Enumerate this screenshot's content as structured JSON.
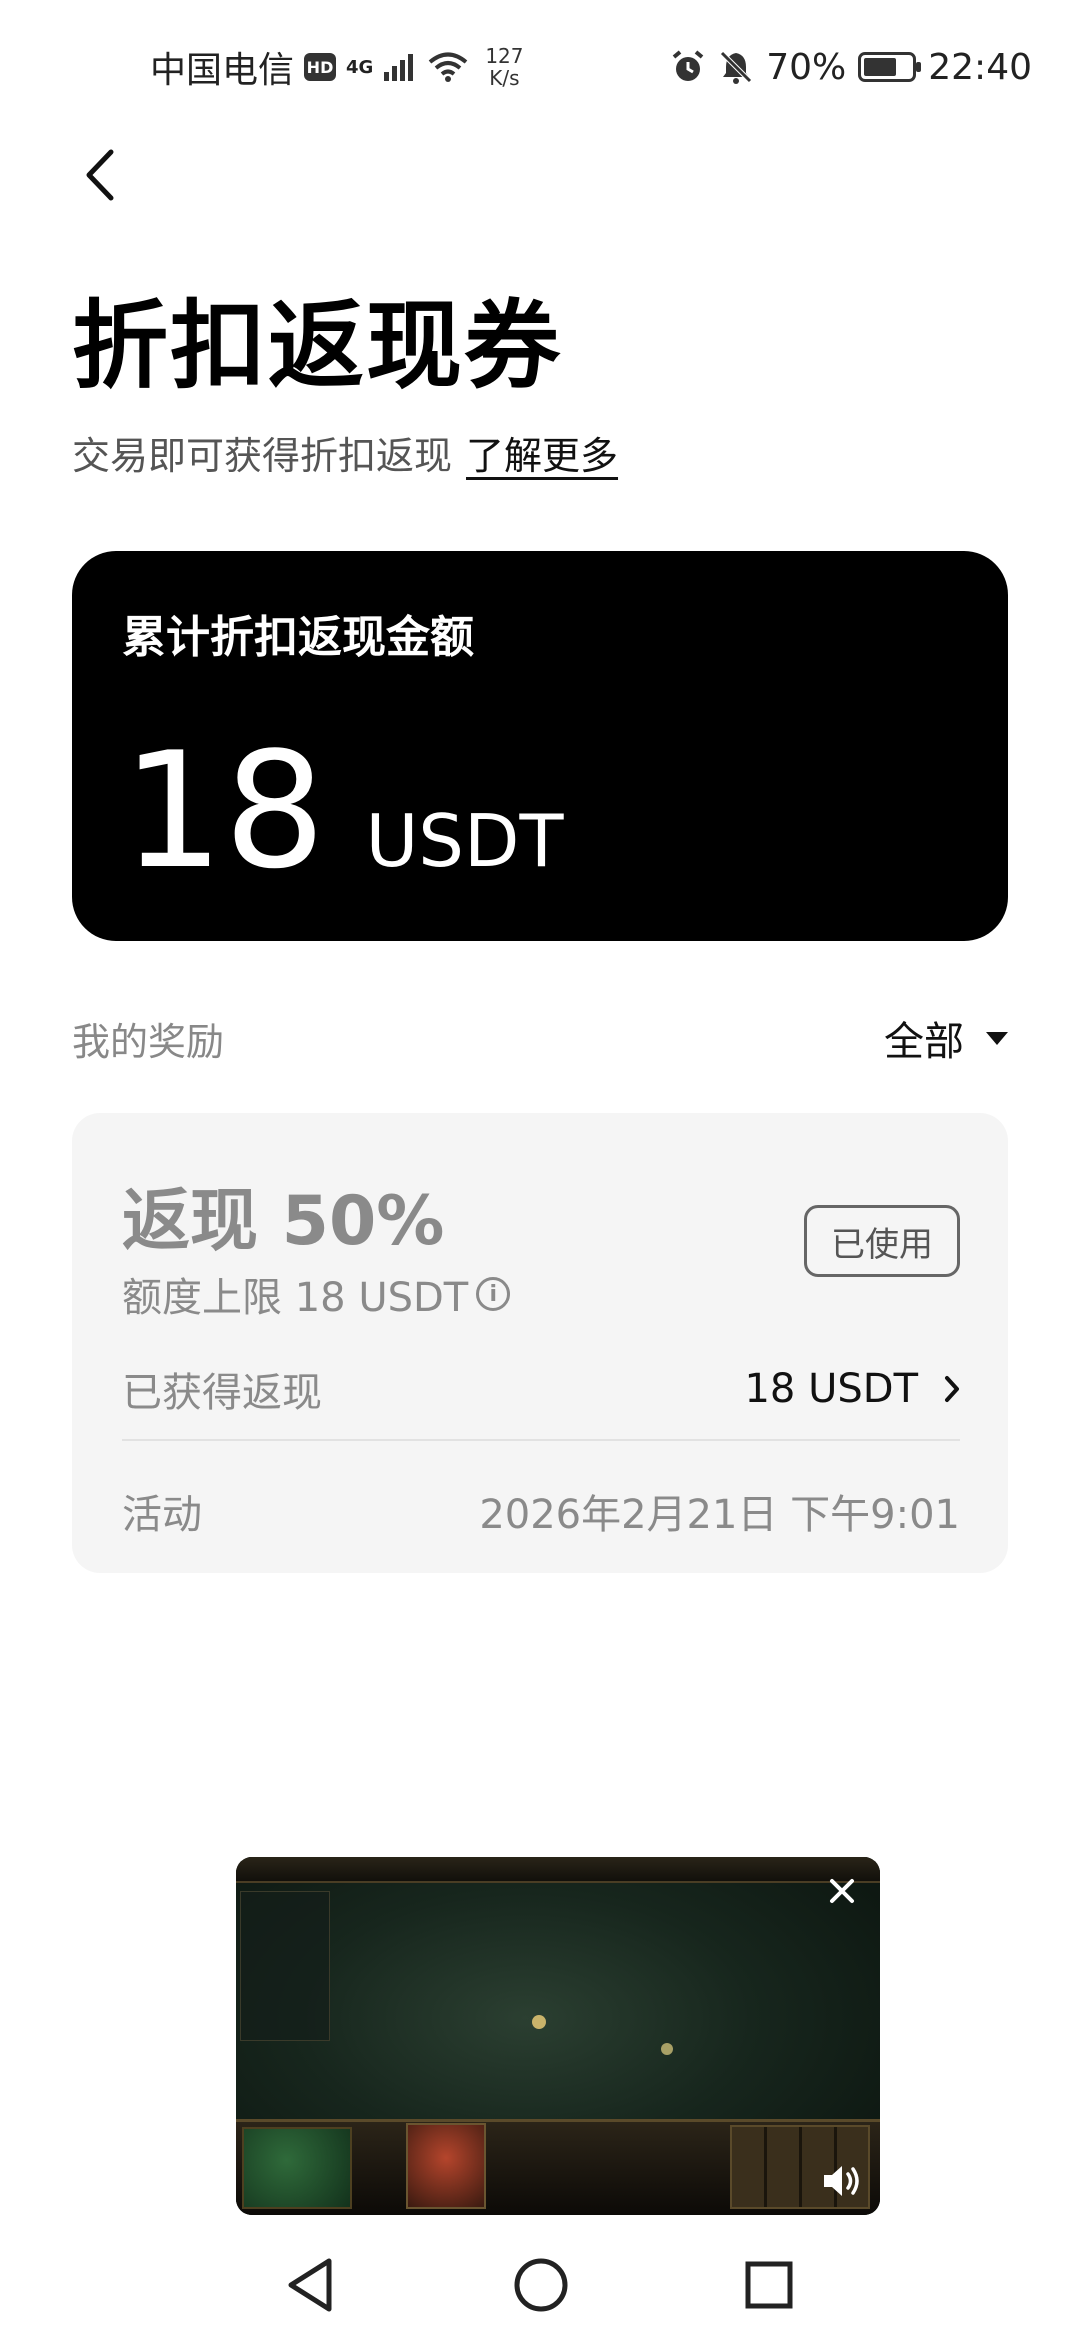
{
  "status_bar": {
    "carrier": "中国电信",
    "hd_badge": "HD",
    "network_type": "4G",
    "net_speed_value": "127",
    "net_speed_unit": "K/s",
    "battery_percent": "70%",
    "battery_level": 0.7,
    "time": "22:40",
    "icons": [
      "signal-icon",
      "wifi-icon",
      "alarm-icon",
      "mute-icon",
      "battery-icon"
    ]
  },
  "header": {
    "back_icon": "back-arrow-icon",
    "title": "折扣返现券",
    "subtitle": "交易即可获得折扣返现",
    "learn_more": "了解更多"
  },
  "total_card": {
    "label": "累计折扣返现金额",
    "amount": "18",
    "unit": "USDT"
  },
  "rewards": {
    "title": "我的奖励",
    "filter_label": "全部",
    "filter_icon": "dropdown-triangle-icon",
    "items": [
      {
        "title": "返现 50%",
        "limit": "额度上限 18 USDT",
        "status": "已使用",
        "earned_label": "已获得返现",
        "earned_value": "18 USDT",
        "activity_label": "活动",
        "activity_time": "2026年2月21日 下午9:01"
      }
    ]
  },
  "video_pip": {
    "close_icon": "close-icon",
    "volume_icon": "volume-icon"
  },
  "nav_bar": {
    "icons": [
      "back-triangle-icon",
      "home-circle-icon",
      "recents-square-icon"
    ]
  },
  "colors": {
    "card_dark": "#000000",
    "card_light": "#f5f5f5",
    "muted_text": "#8a8a8a"
  }
}
